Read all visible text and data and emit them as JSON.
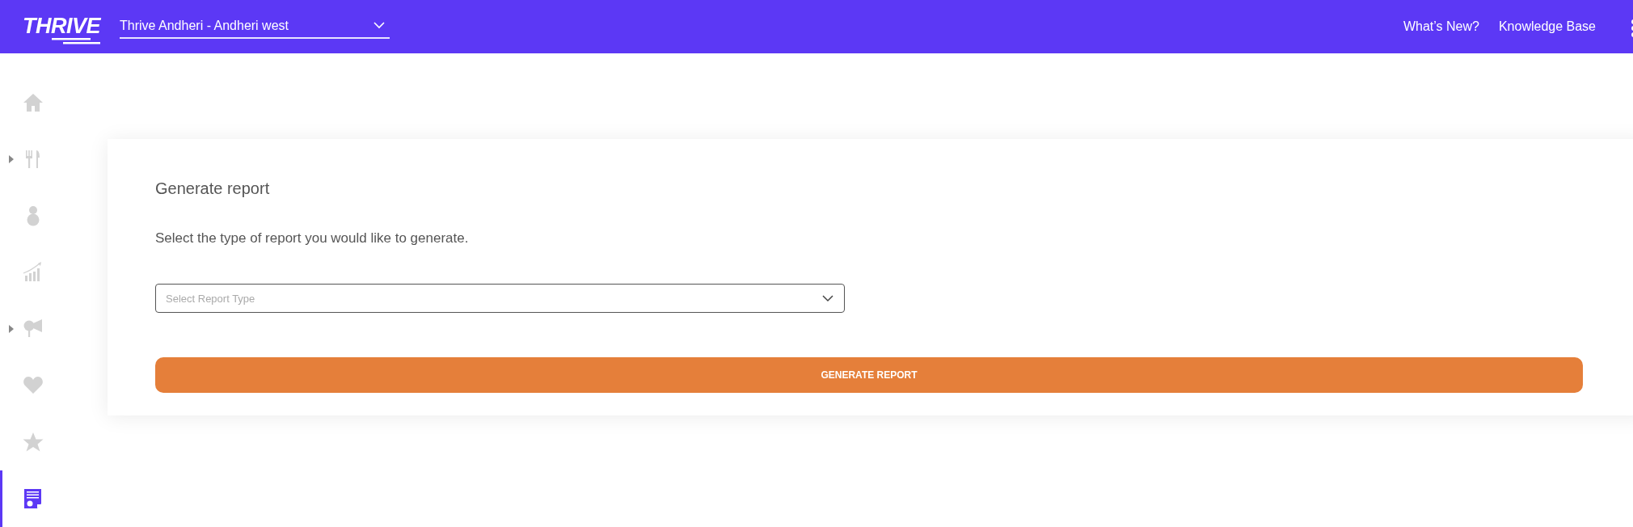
{
  "header": {
    "logo": "THRIVE",
    "location": "Thrive Andheri - Andheri west",
    "links": [
      "What’s New?",
      "Knowledge Base"
    ]
  },
  "sidebar": {
    "items": [
      {
        "kind": "home",
        "expandable": false,
        "selected": false
      },
      {
        "kind": "cutlery",
        "expandable": true,
        "selected": false
      },
      {
        "kind": "person",
        "expandable": false,
        "selected": false
      },
      {
        "kind": "growth",
        "expandable": false,
        "selected": false
      },
      {
        "kind": "megaphone",
        "expandable": true,
        "selected": false
      },
      {
        "kind": "heart",
        "expandable": false,
        "selected": false
      },
      {
        "kind": "star",
        "expandable": false,
        "selected": false
      },
      {
        "kind": "report",
        "expandable": false,
        "selected": true
      }
    ]
  },
  "report": {
    "title": "Generate report",
    "prompt": "Select the type of report you would like to generate.",
    "select": {
      "placeholder": "Select Report Type"
    },
    "button": "GENERATE REPORT"
  }
}
